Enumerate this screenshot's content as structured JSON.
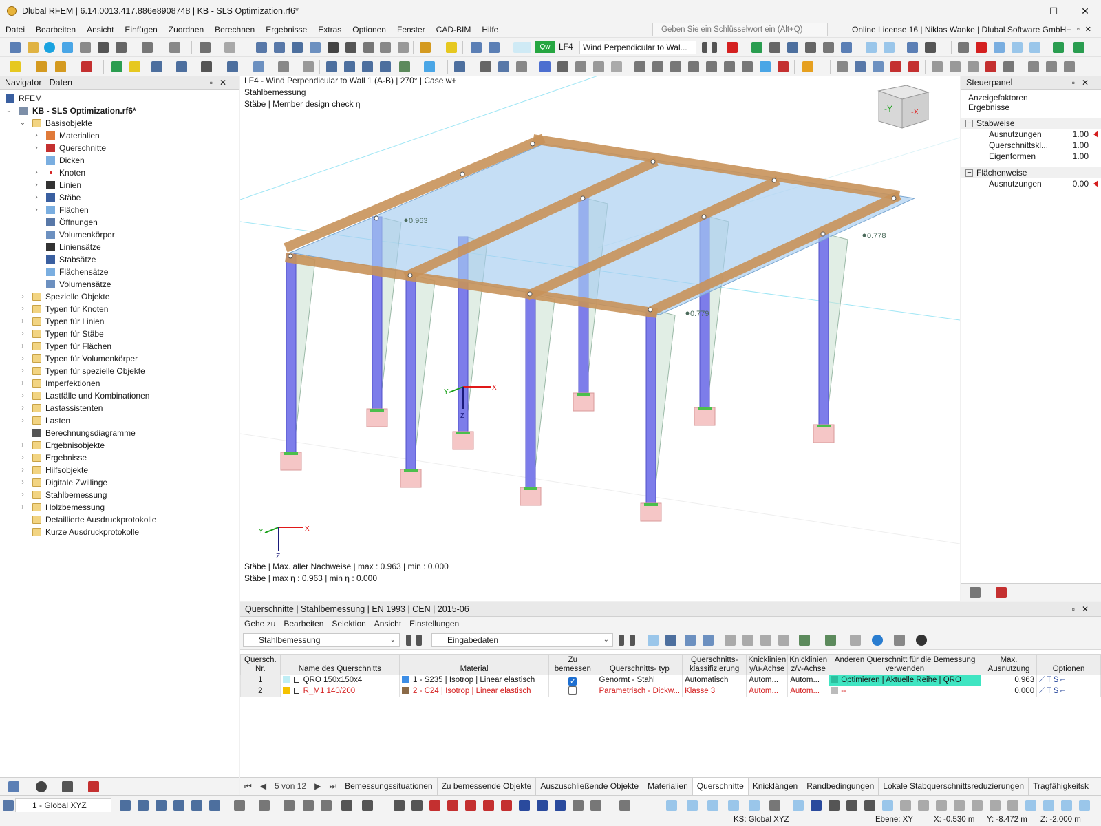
{
  "window": {
    "title": "Dlubal RFEM | 6.14.0013.417.886e8908748 | KB - SLS Optimization.rf6*",
    "buttons": [
      "—",
      "☐",
      "✕"
    ]
  },
  "menu": {
    "items": [
      "Datei",
      "Bearbeiten",
      "Ansicht",
      "Einfügen",
      "Zuordnen",
      "Berechnen",
      "Ergebnisse",
      "Extras",
      "Optionen",
      "Fenster",
      "CAD-BIM",
      "Hilfe"
    ],
    "search_placeholder": "Geben Sie ein Schlüsselwort ein (Alt+Q)",
    "license": "Online License 16 | Niklas Wanke | Dlubal Software GmbH"
  },
  "toolbar": {
    "load_badge": "Qw",
    "load_case": "LF4",
    "load_combo": "Wind Perpendicular to Wal..."
  },
  "navigator": {
    "title": "Navigator - Daten",
    "root": "RFEM",
    "project": "KB - SLS Optimization.rf6*",
    "items": [
      {
        "label": "Basisobjekte",
        "level": 1,
        "exp": "⌄",
        "icon": "folder"
      },
      {
        "label": "Materialien",
        "level": 2,
        "exp": "›",
        "icon": "materials"
      },
      {
        "label": "Querschnitte",
        "level": 2,
        "exp": "›",
        "icon": "section"
      },
      {
        "label": "Dicken",
        "level": 2,
        "exp": "",
        "icon": "thickness"
      },
      {
        "label": "Knoten",
        "level": 2,
        "exp": "›",
        "icon": "node"
      },
      {
        "label": "Linien",
        "level": 2,
        "exp": "›",
        "icon": "line"
      },
      {
        "label": "Stäbe",
        "level": 2,
        "exp": "›",
        "icon": "member"
      },
      {
        "label": "Flächen",
        "level": 2,
        "exp": "›",
        "icon": "surface"
      },
      {
        "label": "Öffnungen",
        "level": 2,
        "exp": "",
        "icon": "opening"
      },
      {
        "label": "Volumenkörper",
        "level": 2,
        "exp": "",
        "icon": "solid"
      },
      {
        "label": "Liniensätze",
        "level": 2,
        "exp": "",
        "icon": "line"
      },
      {
        "label": "Stabsätze",
        "level": 2,
        "exp": "",
        "icon": "member"
      },
      {
        "label": "Flächensätze",
        "level": 2,
        "exp": "",
        "icon": "surface"
      },
      {
        "label": "Volumensätze",
        "level": 2,
        "exp": "",
        "icon": "solid"
      },
      {
        "label": "Spezielle Objekte",
        "level": 1,
        "exp": "›",
        "icon": "folder"
      },
      {
        "label": "Typen für Knoten",
        "level": 1,
        "exp": "›",
        "icon": "folder"
      },
      {
        "label": "Typen für Linien",
        "level": 1,
        "exp": "›",
        "icon": "folder"
      },
      {
        "label": "Typen für Stäbe",
        "level": 1,
        "exp": "›",
        "icon": "folder"
      },
      {
        "label": "Typen für Flächen",
        "level": 1,
        "exp": "›",
        "icon": "folder"
      },
      {
        "label": "Typen für Volumenkörper",
        "level": 1,
        "exp": "›",
        "icon": "folder"
      },
      {
        "label": "Typen für spezielle Objekte",
        "level": 1,
        "exp": "›",
        "icon": "folder"
      },
      {
        "label": "Imperfektionen",
        "level": 1,
        "exp": "›",
        "icon": "folder"
      },
      {
        "label": "Lastfälle und Kombinationen",
        "level": 1,
        "exp": "›",
        "icon": "folder"
      },
      {
        "label": "Lastassistenten",
        "level": 1,
        "exp": "›",
        "icon": "folder"
      },
      {
        "label": "Lasten",
        "level": 1,
        "exp": "›",
        "icon": "folder"
      },
      {
        "label": "Berechnungsdiagramme",
        "level": 1,
        "exp": "",
        "icon": "diagram"
      },
      {
        "label": "Ergebnisobjekte",
        "level": 1,
        "exp": "›",
        "icon": "folder"
      },
      {
        "label": "Ergebnisse",
        "level": 1,
        "exp": "›",
        "icon": "folder"
      },
      {
        "label": "Hilfsobjekte",
        "level": 1,
        "exp": "›",
        "icon": "folder"
      },
      {
        "label": "Digitale Zwillinge",
        "level": 1,
        "exp": "›",
        "icon": "folder"
      },
      {
        "label": "Stahlbemessung",
        "level": 1,
        "exp": "›",
        "icon": "folder"
      },
      {
        "label": "Holzbemessung",
        "level": 1,
        "exp": "›",
        "icon": "folder"
      },
      {
        "label": "Detaillierte Ausdruckprotokolle",
        "level": 1,
        "exp": "",
        "icon": "folder"
      },
      {
        "label": "Kurze Ausdruckprotokolle",
        "level": 1,
        "exp": "",
        "icon": "folder"
      }
    ]
  },
  "viewport": {
    "info_line1": "LF4 - Wind Perpendicular to Wall 1 (A-B) | 270° | Case w+",
    "info_line2": "Stahlbemessung",
    "info_line3": "Stäbe | Member design check η",
    "summary_line1": "Stäbe | Max. aller Nachweise | max  : 0.963 | min  : 0.000",
    "summary_line2": "Stäbe | max η : 0.963 | min η : 0.000",
    "value_labels": [
      "0.963",
      "0.778",
      "0.779"
    ],
    "axes_labels": {
      "x": "X",
      "y": "Y",
      "z": "Z"
    },
    "cube_labels": {
      "front": "-Y",
      "side": "-X"
    }
  },
  "steuerpanel": {
    "title": "Steuerpanel",
    "subtitle_line1": "Anzeigefaktoren",
    "subtitle_line2": "Ergebnisse",
    "groups": [
      {
        "name": "Stabweise",
        "rows": [
          {
            "label": "Ausnutzungen",
            "value": "1.00",
            "flag": true
          },
          {
            "label": "Querschnittskl...",
            "value": "1.00",
            "flag": false
          },
          {
            "label": "Eigenformen",
            "value": "1.00",
            "flag": false
          }
        ]
      },
      {
        "name": "Flächenweise",
        "rows": [
          {
            "label": "Ausnutzungen",
            "value": "0.00",
            "flag": true
          }
        ]
      }
    ]
  },
  "bottom": {
    "title": "Querschnitte | Stahlbemessung | EN 1993 | CEN | 2015-06",
    "menu": [
      "Gehe zu",
      "Bearbeiten",
      "Selektion",
      "Ansicht",
      "Einstellungen"
    ],
    "combo_module": "Stahlbemessung",
    "combo_data": "Eingabedaten",
    "columns": [
      "Quersch. Nr.",
      "Name des Querschnitts",
      "Material",
      "Zu bemessen",
      "Querschnitts- typ",
      "Querschnitts- klassifizierung",
      "Knicklinien y/u-Achse",
      "Knicklinien z/v-Achse",
      "Anderen Querschnitt für die Bemessung verwenden",
      "Max. Ausnutzung",
      "Optionen"
    ],
    "rows": [
      {
        "nr": "1",
        "name": "QRO 150x150x4",
        "name_color": "#bfeef5",
        "material": "1 - S235 | Isotrop | Linear elastisch",
        "mat_color": "#3d8ee6",
        "design": true,
        "type": "Genormt - Stahl",
        "class": "Automatisch",
        "y_axis": "Autom...",
        "z_axis": "Autom...",
        "other": "Optimieren | Aktuelle Reihe | QRO",
        "max": "0.963",
        "red": false
      },
      {
        "nr": "2",
        "name": "R_M1 140/200",
        "name_color": "#f5c200",
        "material": "2 - C24 | Isotrop | Linear elastisch",
        "mat_color": "#8b6a48",
        "design": false,
        "type": "Parametrisch - Dickw...",
        "class": "Klasse 3",
        "y_axis": "Autom...",
        "z_axis": "Autom...",
        "other": "--",
        "max": "0.000",
        "red": true
      }
    ],
    "page": "5 von 12",
    "tabs": [
      "Bemessungssituationen",
      "Zu bemessende Objekte",
      "Auszuschließende Objekte",
      "Materialien",
      "Querschnitte",
      "Knicklängen",
      "Randbedingungen",
      "Lokale Stabquerschnittsreduzierungen",
      "Tragfähigkeitsk"
    ],
    "active_tab": "Querschnitte"
  },
  "status": {
    "cs": "1 - Global XYZ",
    "ks": "KS: Global XYZ",
    "ebene": "Ebene: XY",
    "x": "X: -0.530 m",
    "y": "Y: -8.472 m",
    "z": "Z: -2.000 m"
  }
}
